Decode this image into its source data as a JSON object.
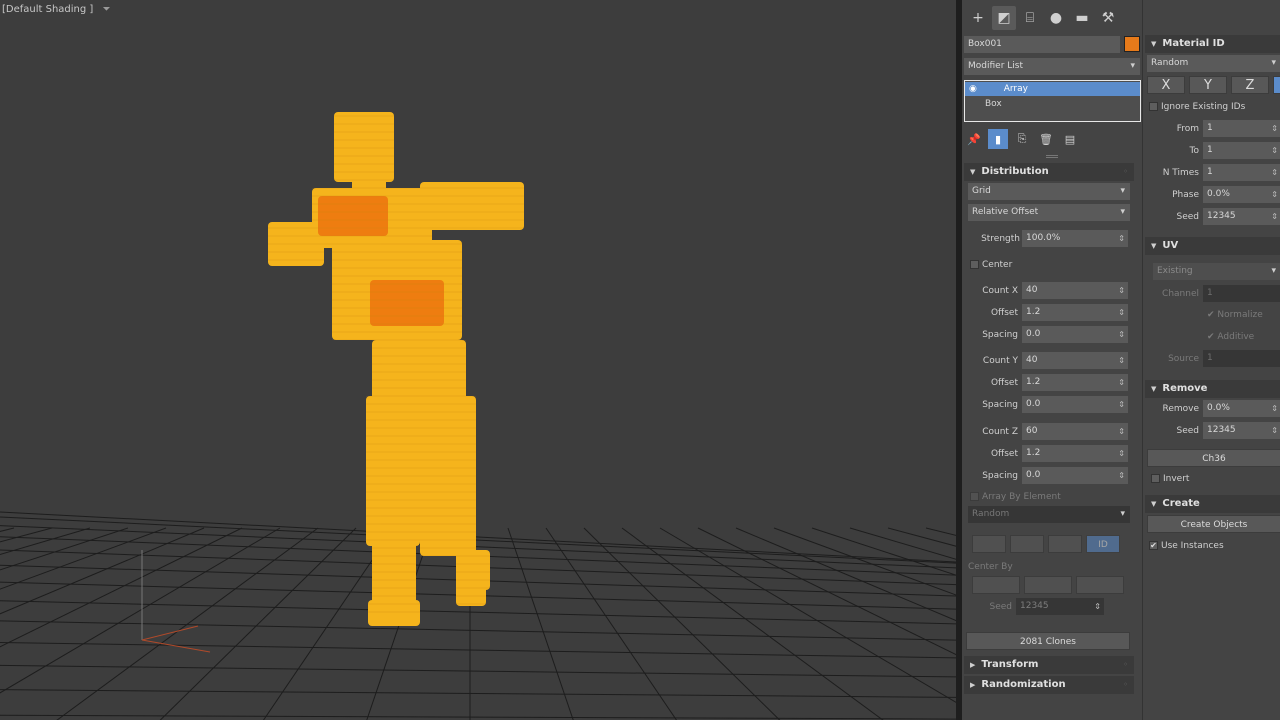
{
  "viewport": {
    "label": "[Default Shading ]",
    "filter_icon": "funnel-icon",
    "figure_color": "#f5b41c",
    "figure_shadow_color": "#ee7d10",
    "background": "#3d3d3d"
  },
  "panel": {
    "tabs": [
      {
        "icon": "create-icon",
        "glyph": "+"
      },
      {
        "icon": "modify-icon",
        "glyph": "◩"
      },
      {
        "icon": "hierarchy-icon",
        "glyph": "⌸"
      },
      {
        "icon": "motion-icon",
        "glyph": "●"
      },
      {
        "icon": "display-icon",
        "glyph": "▬"
      },
      {
        "icon": "utilities-icon",
        "glyph": "🔧"
      }
    ],
    "object_name": "Box001",
    "object_color": "#e67a1a",
    "modifier_list": "Modifier List",
    "stack": [
      "Array",
      "Box"
    ],
    "distribution": {
      "title": "Distribution",
      "type": "Grid",
      "offset_mode": "Relative Offset",
      "strength_label": "Strength",
      "strength_value": "100.0%",
      "center_label": "Center",
      "count_x_label": "Count X",
      "count_x": "40",
      "offset_x_label": "Offset",
      "offset_x": "1.2",
      "spacing_x_label": "Spacing",
      "spacing_x": "0.0",
      "count_y_label": "Count Y",
      "count_y": "40",
      "offset_y_label": "Offset",
      "offset_y": "1.2",
      "spacing_y_label": "Spacing",
      "spacing_y": "0.0",
      "count_z_label": "Count Z",
      "count_z": "60",
      "offset_z_label": "Offset",
      "offset_z": "1.2",
      "spacing_z_label": "Spacing",
      "spacing_z": "0.0",
      "array_by_element": "Array By Element",
      "random": "Random",
      "id_button": "ID",
      "center_by": "Center By",
      "seed_label": "Seed",
      "seed_value": "12345",
      "clones": "2081 Clones"
    },
    "transform_title": "Transform",
    "randomization_title": "Randomization",
    "material_id": {
      "title": "Material ID",
      "mode": "Random",
      "x": "X",
      "y": "Y",
      "z": "Z",
      "ignore_existing": "Ignore Existing IDs",
      "from_label": "From",
      "from": "1",
      "to_label": "To",
      "to": "1",
      "ntimes_label": "N Times",
      "ntimes": "1",
      "phase_label": "Phase",
      "phase": "0.0%",
      "seed_label": "Seed",
      "seed": "12345"
    },
    "uv": {
      "title": "UV",
      "mode": "Existing",
      "channel_label": "Channel",
      "channel": "1",
      "normalize": "Normalize",
      "additive": "Additive",
      "source_label": "Source",
      "source": "1"
    },
    "remove": {
      "title": "Remove",
      "remove_label": "Remove",
      "remove": "0.0%",
      "seed_label": "Seed",
      "seed": "12345",
      "channel_button": "Ch36",
      "invert": "Invert"
    },
    "create": {
      "title": "Create",
      "button": "Create Objects",
      "use_instances": "Use Instances"
    }
  }
}
